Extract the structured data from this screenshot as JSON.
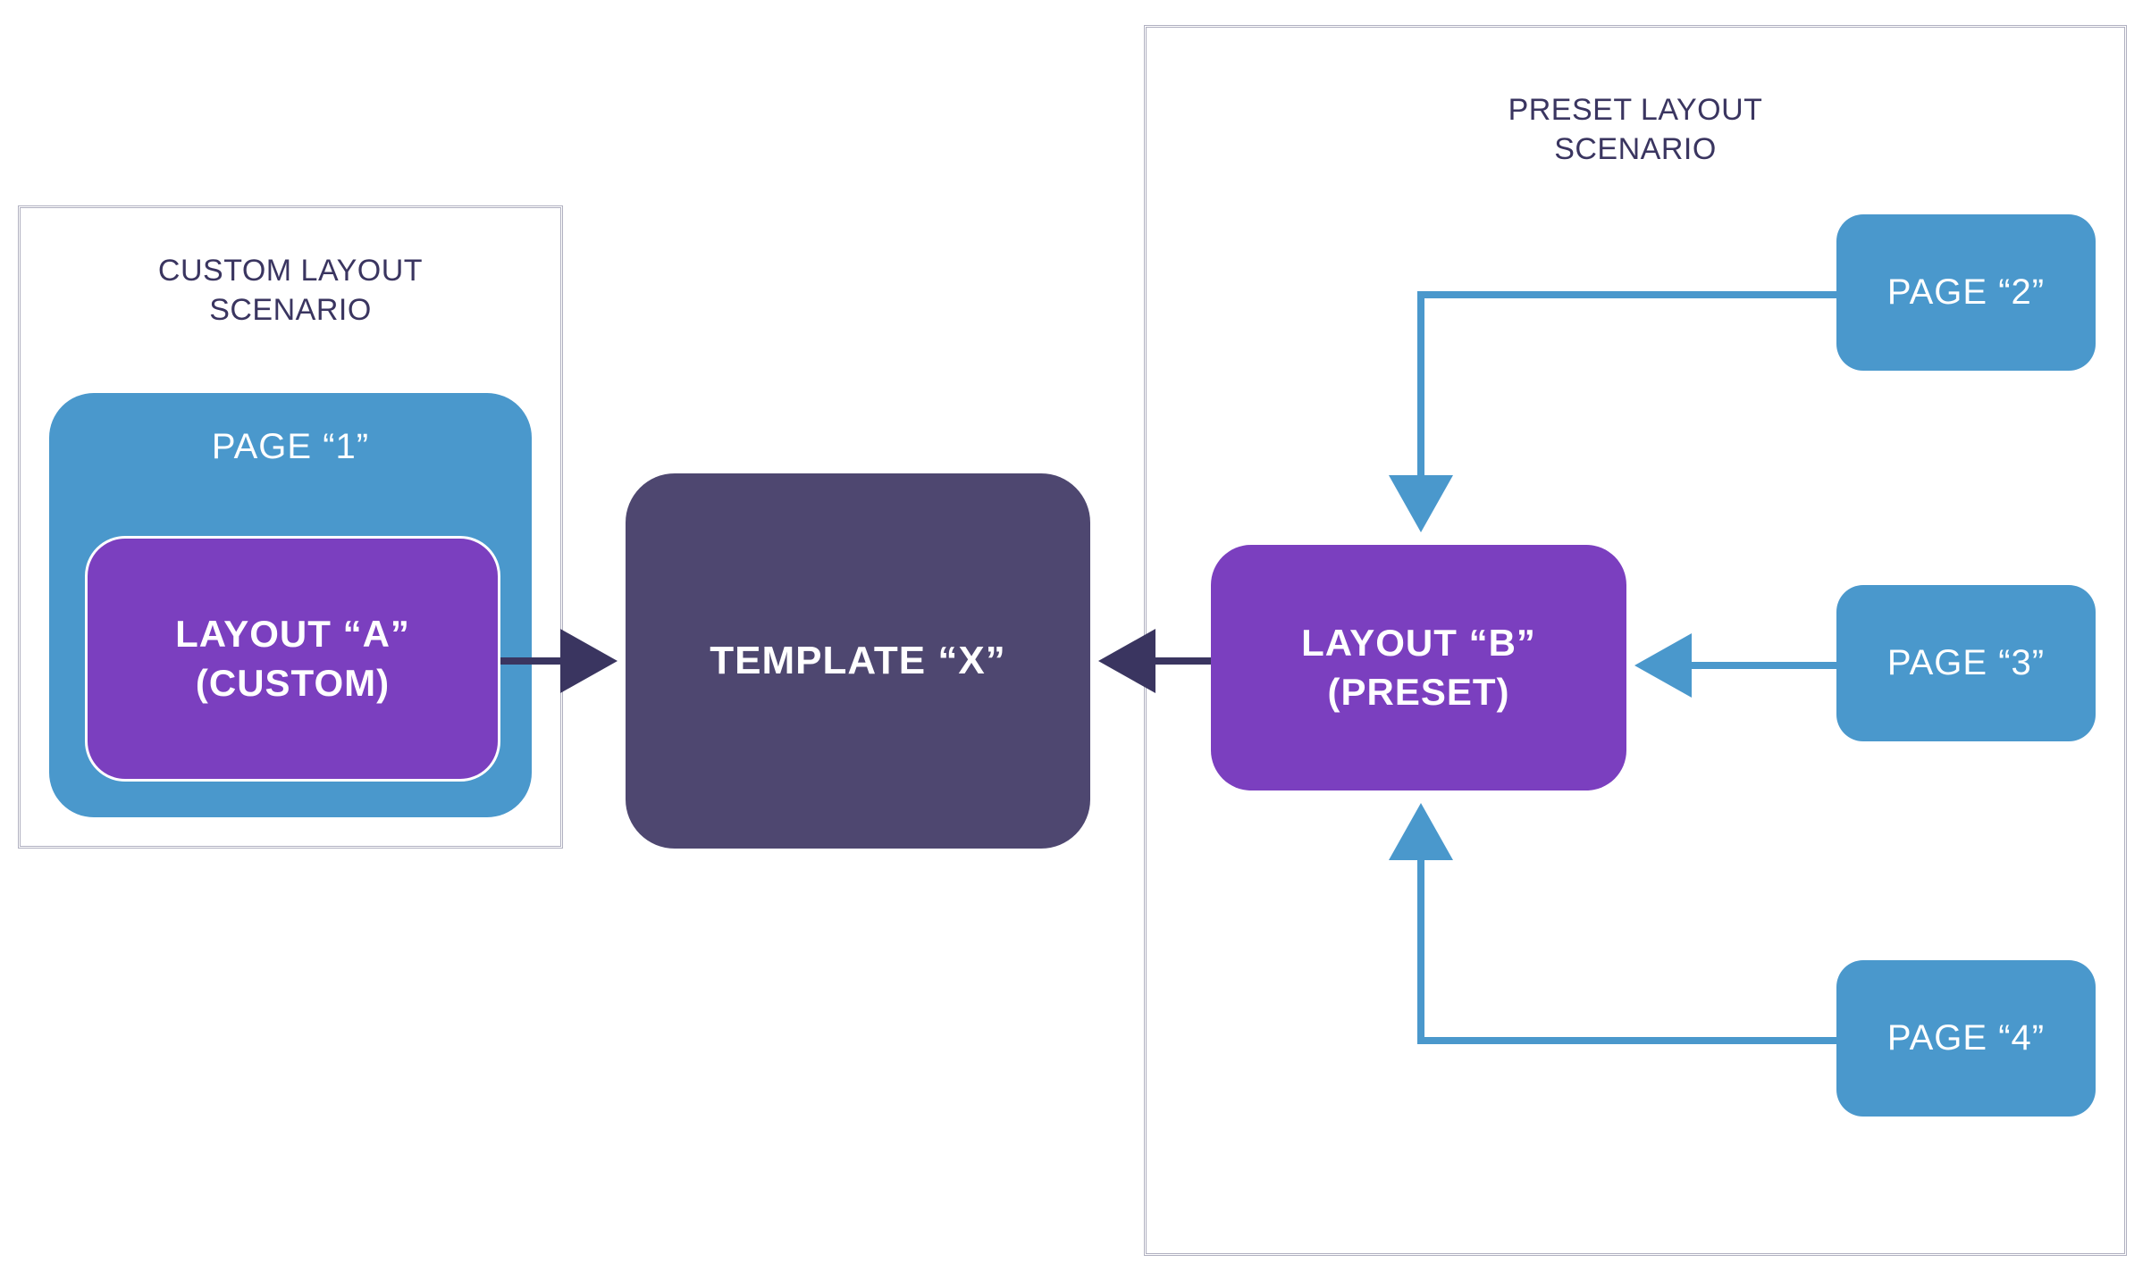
{
  "scenarios": {
    "custom": {
      "label_line1": "CUSTOM LAYOUT",
      "label_line2": "SCENARIO"
    },
    "preset": {
      "label_line1": "PRESET LAYOUT",
      "label_line2": "SCENARIO"
    }
  },
  "pages": {
    "page1": "PAGE “1”",
    "page2": "PAGE “2”",
    "page3": "PAGE “3”",
    "page4": "PAGE “4”"
  },
  "layouts": {
    "layout_a_line1": "LAYOUT “A”",
    "layout_a_line2": "(CUSTOM)",
    "layout_b_line1": "LAYOUT “B”",
    "layout_b_line2": "(PRESET)"
  },
  "template": {
    "label": "TEMPLATE “X”"
  },
  "colors": {
    "box_blue": "#4a98cc",
    "box_purple": "#7b3fbf",
    "box_dark_purple": "#4e4770",
    "frame_border": "#b0b0c0",
    "text_navy": "#3a3560",
    "arrow_dark": "#3a3560",
    "arrow_blue": "#4a98cc"
  }
}
